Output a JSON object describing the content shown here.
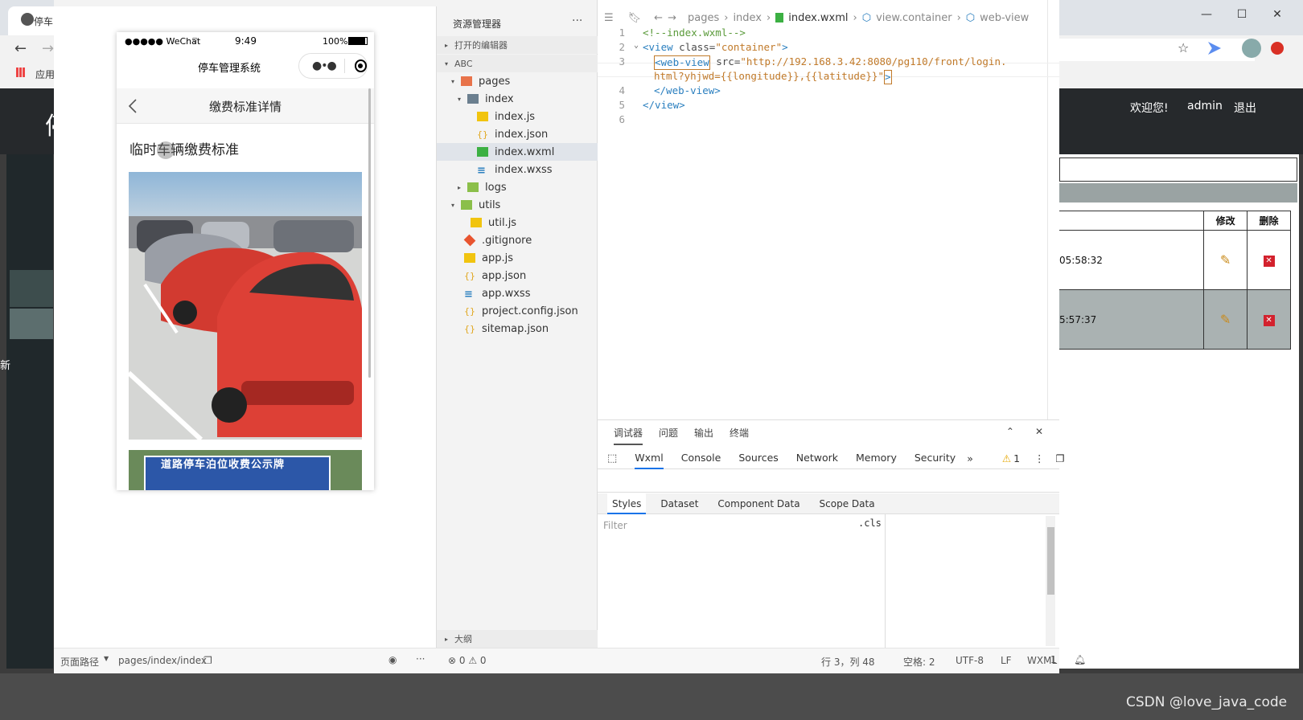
{
  "browser": {
    "tab_title": "停车",
    "bookmark_label": "应用"
  },
  "website": {
    "welcome": "欢迎您!",
    "username": "admin",
    "logout": "退出",
    "sidebar_glyph": "新",
    "table": {
      "headers": [
        "修改",
        "删除"
      ],
      "rows": [
        {
          "time": "05:58:32"
        },
        {
          "time": "5:57:37"
        }
      ]
    }
  },
  "simulator": {
    "status": {
      "carrier": "●●●●● WeChat",
      "time": "9:49",
      "battery": "100%"
    },
    "app_title": "停车管理系统",
    "page_title": "缴费标准详情",
    "heading": "临时车辆缴费标准",
    "sign_text": "道路停车泊位收费公示牌",
    "footer": {
      "path_label": "页面路径",
      "path_value": "pages/index/index"
    }
  },
  "explorer": {
    "title": "资源管理器",
    "open_editors": "打开的编辑器",
    "project": "ABC",
    "outline": "大纲",
    "tree": [
      {
        "label": "pages"
      },
      {
        "label": "index"
      },
      {
        "label": "index.js"
      },
      {
        "label": "index.json"
      },
      {
        "label": "index.wxml"
      },
      {
        "label": "index.wxss"
      },
      {
        "label": "logs"
      },
      {
        "label": "utils"
      },
      {
        "label": "util.js"
      },
      {
        "label": ".gitignore"
      },
      {
        "label": "app.js"
      },
      {
        "label": "app.json"
      },
      {
        "label": "app.wxss"
      },
      {
        "label": "project.config.json"
      },
      {
        "label": "sitemap.json"
      }
    ]
  },
  "editor": {
    "breadcrumb": [
      "pages",
      "index",
      "index.wxml",
      "view.container",
      "web-view"
    ],
    "lines": [
      {
        "n": "1",
        "comment": "<!--index.wxml-->"
      },
      {
        "n": "2",
        "open": "<view",
        "attr": " class=",
        "val": "\"container\"",
        "close": ">"
      },
      {
        "n": "3",
        "open": "<web-view",
        "attr": " src=",
        "val": "\"http://192.168.3.42:8080/pg110/front/login."
      },
      {
        "n": "",
        "val": "html?yhjwd={{longitude}},{{latitude}}\"",
        "close": ">"
      },
      {
        "n": "4",
        "open": "</web-view>"
      },
      {
        "n": "5",
        "open": "</view>"
      },
      {
        "n": "6"
      }
    ]
  },
  "debugger": {
    "tabs": [
      "调试器",
      "问题",
      "输出",
      "终端"
    ],
    "devtools_tabs": [
      "Wxml",
      "Console",
      "Sources",
      "Network",
      "Memory",
      "Security"
    ],
    "warning_count": "1",
    "sub_tabs": [
      "Styles",
      "Dataset",
      "Component Data",
      "Scope Data"
    ],
    "filter_placeholder": "Filter",
    "cls_label": ".cls"
  },
  "statusbar": {
    "errors": "⊗ 0 ⚠ 0",
    "position": "行 3，列 48",
    "spaces": "空格: 2",
    "encoding": "UTF-8",
    "eol": "LF",
    "language": "WXML",
    "notifications": "1"
  },
  "watermark": "CSDN @love_java_code"
}
